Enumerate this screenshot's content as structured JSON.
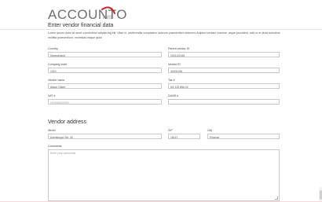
{
  "brand": {
    "name": "ACCOUNTO",
    "suffix": "TMS",
    "accent": "#c0282d"
  },
  "form": {
    "title": "Enter vendor financial data",
    "lead": "Lorem ipsum dolor sit amet consectetur adipisicing elit. Vitae in, perferendis voluptatem dolorum praesentium dolorem! Adipisci veniam maxime, atque provident, odio ut et dicta doloribus mollitia praesentium, molestias eaque quia!"
  },
  "fields": {
    "country": {
      "label": "Country",
      "value": "Deutschland"
    },
    "parent_vendor_id": {
      "label": "Parent vendor ID",
      "value": "0021122451"
    },
    "company_code": {
      "label": "Company code",
      "value": "1010"
    },
    "vendor_id": {
      "label": "Vendor ID",
      "value": "40000156"
    },
    "vendor_name": {
      "label": "Vendor name",
      "value": "Alison Gilder"
    },
    "tax_no": {
      "label": "Tax #",
      "value": "DE 125 856 02"
    },
    "vat_no": {
      "label": "VAT #",
      "placeholder": "DE0000000000"
    },
    "duns_no": {
      "label": "DUNS #",
      "value": ""
    }
  },
  "address": {
    "section_title": "Vendor address",
    "street": {
      "label": "Street",
      "value": "Aventinsper Str. 26"
    },
    "zip": {
      "label": "ZIP",
      "value": "18147"
    },
    "city": {
      "label": "City",
      "value": "Rostock"
    },
    "comments": {
      "label": "Comments",
      "placeholder": "Enter your comments"
    }
  }
}
